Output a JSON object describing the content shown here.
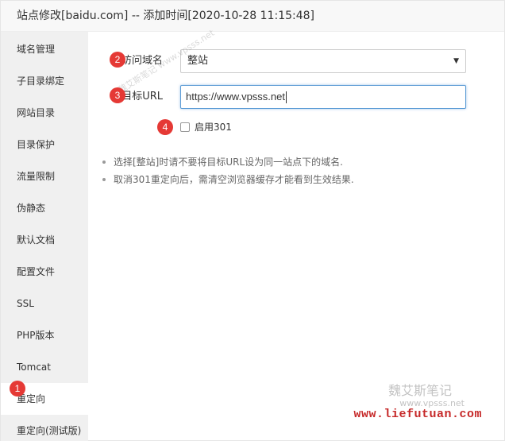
{
  "window": {
    "title": "站点修改[baidu.com] -- 添加时间[2020-10-28 11:15:48]"
  },
  "sidebar": {
    "items": [
      {
        "label": "域名管理"
      },
      {
        "label": "子目录绑定"
      },
      {
        "label": "网站目录"
      },
      {
        "label": "目录保护"
      },
      {
        "label": "流量限制"
      },
      {
        "label": "伪静态"
      },
      {
        "label": "默认文档"
      },
      {
        "label": "配置文件"
      },
      {
        "label": "SSL"
      },
      {
        "label": "PHP版本"
      },
      {
        "label": "Tomcat"
      },
      {
        "label": "重定向",
        "active": true
      },
      {
        "label": "重定向(测试版)"
      }
    ]
  },
  "form": {
    "access_domain_label": "访问域名",
    "access_domain_value": "整站",
    "target_url_label": "目标URL",
    "target_url_value": "https://www.vpsss.net",
    "enable_301_label": "启用301",
    "enable_301_checked": false
  },
  "notes": [
    "选择[整站]时请不要将目标URL设为同一站点下的域名.",
    "取消301重定向后，需清空浏览器缓存才能看到生效结果."
  ],
  "badges": {
    "b1": "1",
    "b2": "2",
    "b3": "3",
    "b4": "4"
  },
  "watermark": {
    "diagonal_text": "魏艾斯笔记 www.vpsss.net",
    "brand_cn": "魏艾斯笔记",
    "brand_url_small": "www.vpsss.net",
    "brand_url_red": "www.liefutuan.com"
  },
  "colors": {
    "badge": "#e53935",
    "input_focus_border": "#5b9bd5",
    "sidebar_bg": "#f0f0f0",
    "watermark_red": "#c62828"
  }
}
